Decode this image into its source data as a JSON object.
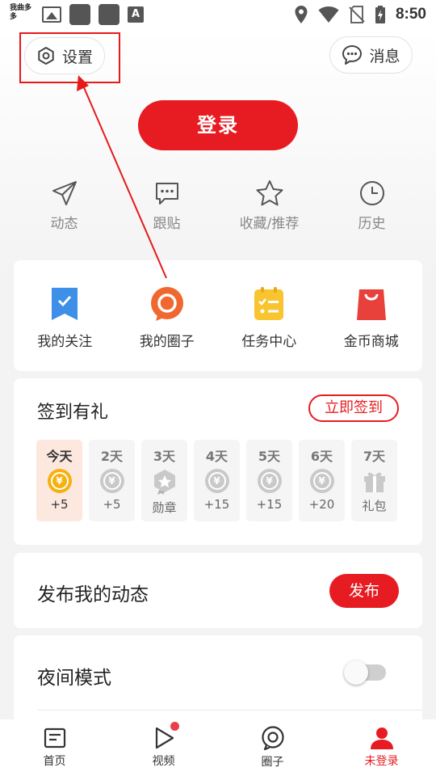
{
  "status_bar": {
    "app_badge": "我曲多多",
    "time": "8:50",
    "icons": [
      "image-icon",
      "app-square-icon",
      "app-square-icon",
      "font-a-icon",
      "location-icon",
      "wifi-icon",
      "no-sim-icon",
      "battery-charging-icon"
    ]
  },
  "header": {
    "settings_label": "设置",
    "messages_label": "消息"
  },
  "login": {
    "label": "登录"
  },
  "quick_actions": [
    {
      "label": "动态",
      "icon": "send-icon"
    },
    {
      "label": "跟贴",
      "icon": "comment-icon"
    },
    {
      "label": "收藏/推荐",
      "icon": "star-icon"
    },
    {
      "label": "历史",
      "icon": "clock-icon"
    }
  ],
  "features": [
    {
      "label": "我的关注",
      "icon": "bookmark-icon"
    },
    {
      "label": "我的圈子",
      "icon": "circle-chat-icon"
    },
    {
      "label": "任务中心",
      "icon": "task-list-icon"
    },
    {
      "label": "金币商城",
      "icon": "shopping-bag-icon"
    }
  ],
  "checkin": {
    "title": "签到有礼",
    "button": "立即签到",
    "days": [
      {
        "label": "今天",
        "reward": "+5",
        "icon": "gold-coin-icon"
      },
      {
        "label": "2天",
        "reward": "+5",
        "icon": "coin-icon"
      },
      {
        "label": "3天",
        "reward": "勋章",
        "icon": "medal-icon"
      },
      {
        "label": "4天",
        "reward": "+15",
        "icon": "coin-icon"
      },
      {
        "label": "5天",
        "reward": "+15",
        "icon": "coin-icon"
      },
      {
        "label": "6天",
        "reward": "+20",
        "icon": "coin-icon"
      },
      {
        "label": "7天",
        "reward": "礼包",
        "icon": "gift-icon"
      }
    ],
    "coin_symbol": "¥"
  },
  "publish": {
    "title": "发布我的动态",
    "button": "发布"
  },
  "night_mode": {
    "title": "夜间模式",
    "enabled": false
  },
  "tabs": [
    {
      "label": "首页",
      "icon": "home-icon"
    },
    {
      "label": "视频",
      "icon": "video-play-icon"
    },
    {
      "label": "圈子",
      "icon": "circle-icon"
    },
    {
      "label": "未登录",
      "icon": "user-icon"
    }
  ],
  "colors": {
    "accent": "#e71c22",
    "gold": "#f6b10e",
    "annotation": "#e51a1a"
  }
}
